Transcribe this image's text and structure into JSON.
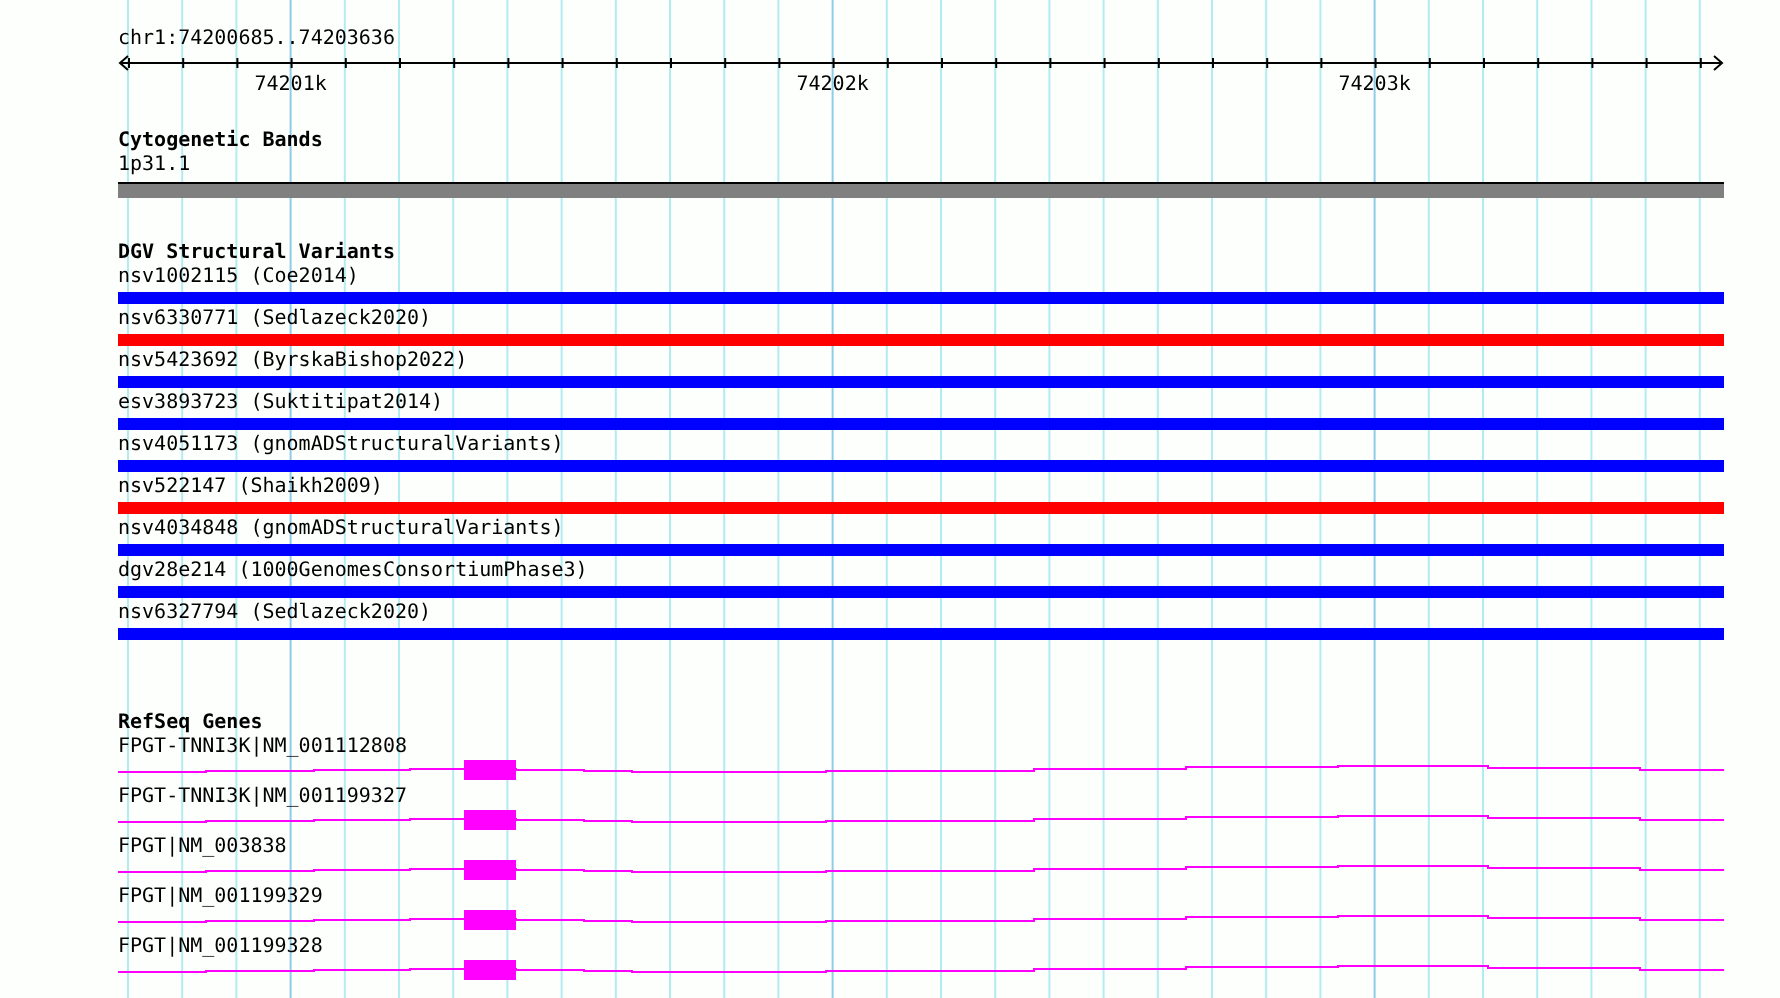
{
  "location": "chr1:74200685..74203636",
  "ruler": {
    "tick_labels": [
      "74201k",
      "74202k",
      "74203k"
    ]
  },
  "cytobands": {
    "title": "Cytogenetic Bands",
    "band": "1p31.1"
  },
  "dgv": {
    "title": "DGV Structural Variants",
    "variants": [
      {
        "label": "nsv1002115 (Coe2014)",
        "color": "#0000ff"
      },
      {
        "label": "nsv6330771 (Sedlazeck2020)",
        "color": "#ff0000"
      },
      {
        "label": "nsv5423692 (ByrskaBishop2022)",
        "color": "#0000ff"
      },
      {
        "label": "esv3893723 (Suktitipat2014)",
        "color": "#0000ff"
      },
      {
        "label": "nsv4051173 (gnomADStructuralVariants)",
        "color": "#0000ff"
      },
      {
        "label": "nsv522147 (Shaikh2009)",
        "color": "#ff0000"
      },
      {
        "label": "nsv4034848 (gnomADStructuralVariants)",
        "color": "#0000ff"
      },
      {
        "label": "dgv28e214 (1000GenomesConsortiumPhase3)",
        "color": "#0000ff"
      },
      {
        "label": "nsv6327794 (Sedlazeck2020)",
        "color": "#0000ff"
      }
    ]
  },
  "refseq": {
    "title": "RefSeq Genes",
    "genes": [
      {
        "label": "FPGT-TNNI3K|NM_001112808"
      },
      {
        "label": "FPGT-TNNI3K|NM_001199327"
      },
      {
        "label": "FPGT|NM_003838"
      },
      {
        "label": "FPGT|NM_001199329"
      },
      {
        "label": "FPGT|NM_001199328"
      }
    ]
  }
}
